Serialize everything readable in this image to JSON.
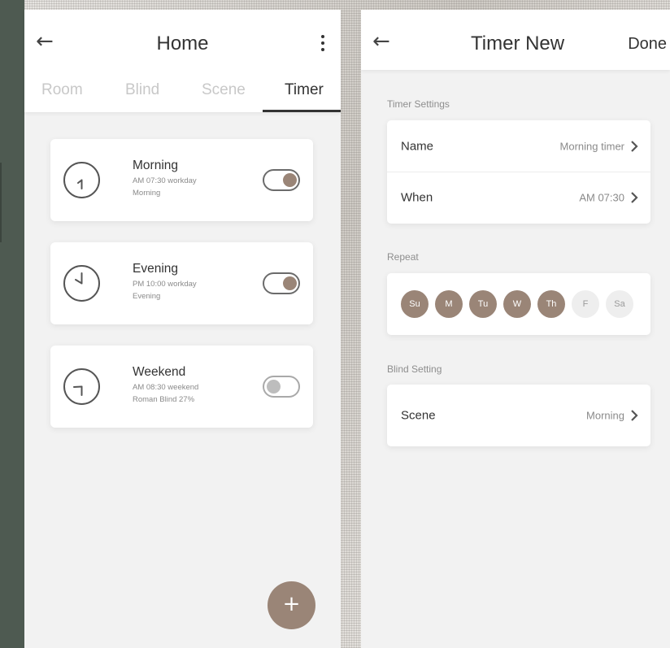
{
  "colors": {
    "accent": "#9a8577",
    "sidebar": "#4e5a51",
    "screen_bg": "#f2f2f2"
  },
  "left": {
    "title": "Home",
    "tabs": [
      {
        "label": "Room",
        "active": false
      },
      {
        "label": "Blind",
        "active": false
      },
      {
        "label": "Scene",
        "active": false
      },
      {
        "label": "Timer",
        "active": true
      }
    ],
    "timers": [
      {
        "name": "Morning",
        "line1": "AM 07:30 workday",
        "line2": "Morning",
        "enabled": true,
        "icon": "clock-icon"
      },
      {
        "name": "Evening",
        "line1": "PM 10:00 workday",
        "line2": "Evening",
        "enabled": true,
        "icon": "clock-icon"
      },
      {
        "name": "Weekend",
        "line1": "AM 08:30 weekend",
        "line2": "Roman Blind 27%",
        "enabled": false,
        "icon": "clock-icon"
      }
    ],
    "fab_label": "+"
  },
  "right": {
    "title": "Timer New",
    "done_label": "Done",
    "timer_settings": {
      "label": "Timer Settings",
      "name_label": "Name",
      "name_value": "Morning timer",
      "when_label": "When",
      "when_value": "AM 07:30"
    },
    "repeat": {
      "label": "Repeat",
      "days": [
        {
          "label": "Su",
          "selected": true
        },
        {
          "label": "M",
          "selected": true
        },
        {
          "label": "Tu",
          "selected": true
        },
        {
          "label": "W",
          "selected": true
        },
        {
          "label": "Th",
          "selected": true
        },
        {
          "label": "F",
          "selected": false
        },
        {
          "label": "Sa",
          "selected": false
        }
      ]
    },
    "blind_setting": {
      "label": "Blind Setting",
      "scene_label": "Scene",
      "scene_value": "Morning"
    }
  }
}
